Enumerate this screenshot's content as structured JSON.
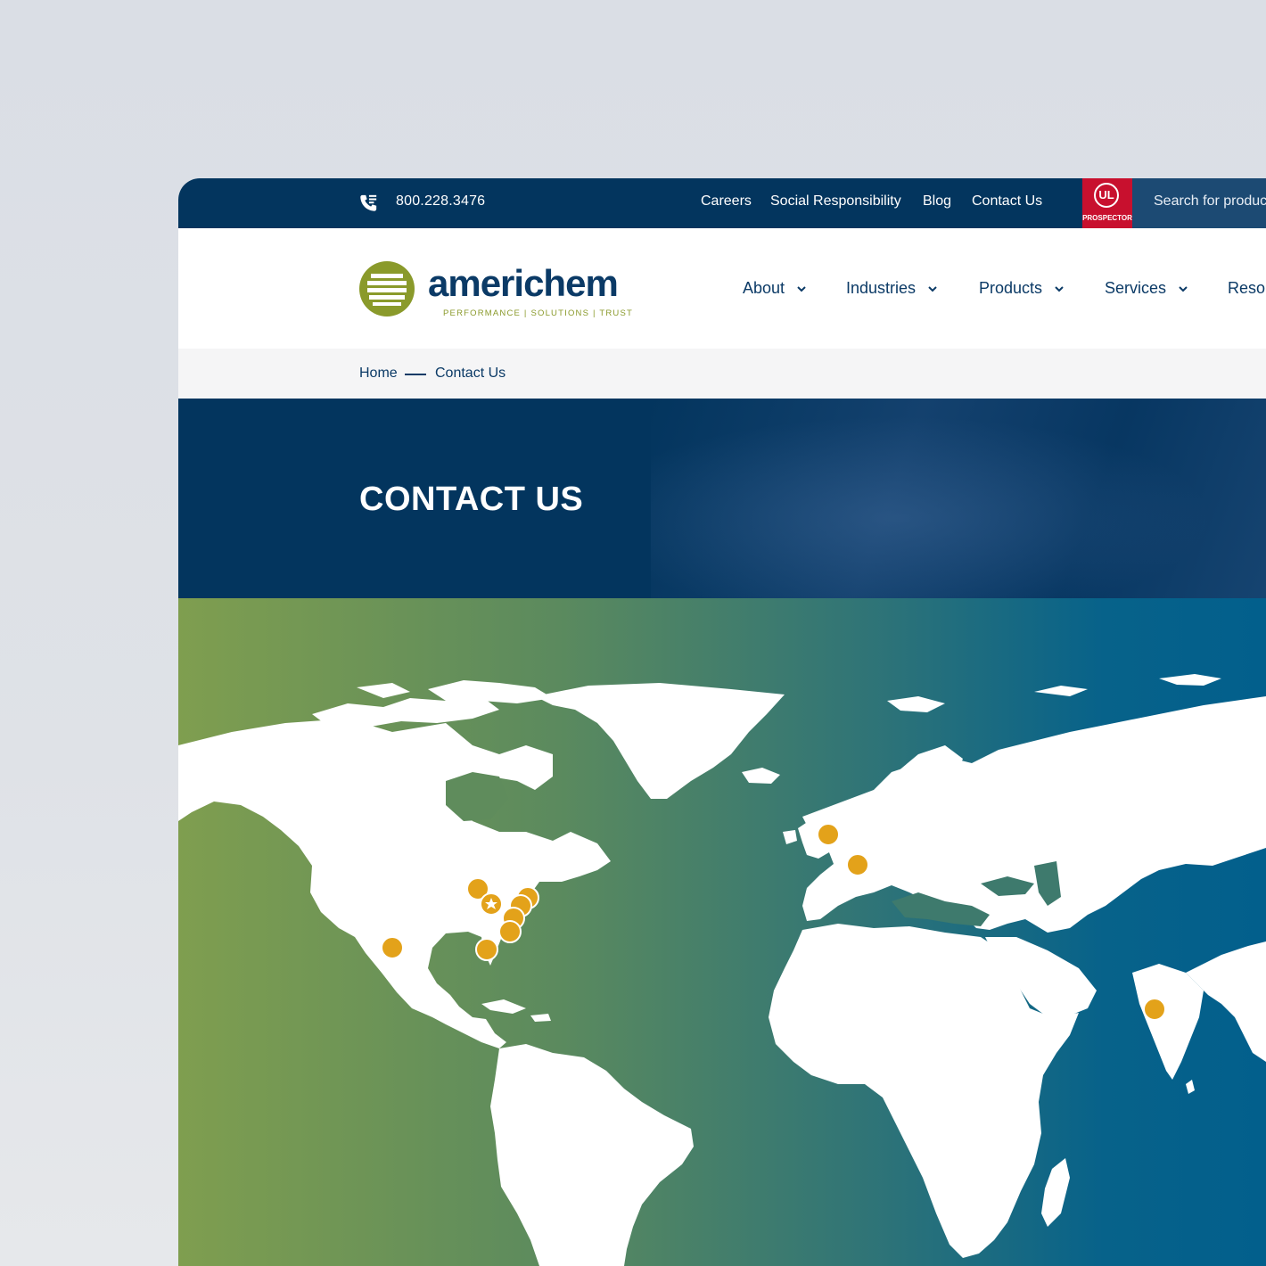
{
  "topbar": {
    "phone": "800.228.3476",
    "links": [
      "Careers",
      "Social Responsibility",
      "Blog",
      "Contact Us"
    ],
    "badge_text": "PROSPECTOR",
    "badge_logo": "UL",
    "search_placeholder": "Search for produc"
  },
  "header": {
    "logo_word": "americhem",
    "logo_tagline": "PERFORMANCE  |  SOLUTIONS  |  TRUST",
    "nav": [
      "About",
      "Industries",
      "Products",
      "Services",
      "Resou"
    ]
  },
  "breadcrumb": {
    "home": "Home",
    "current": "Contact Us"
  },
  "hero": {
    "title": "CONTACT US"
  },
  "colors": {
    "navy": "#03355e",
    "brand_green": "#8a9a2b",
    "marker": "#e3a21a",
    "ul_red": "#c8102e"
  }
}
